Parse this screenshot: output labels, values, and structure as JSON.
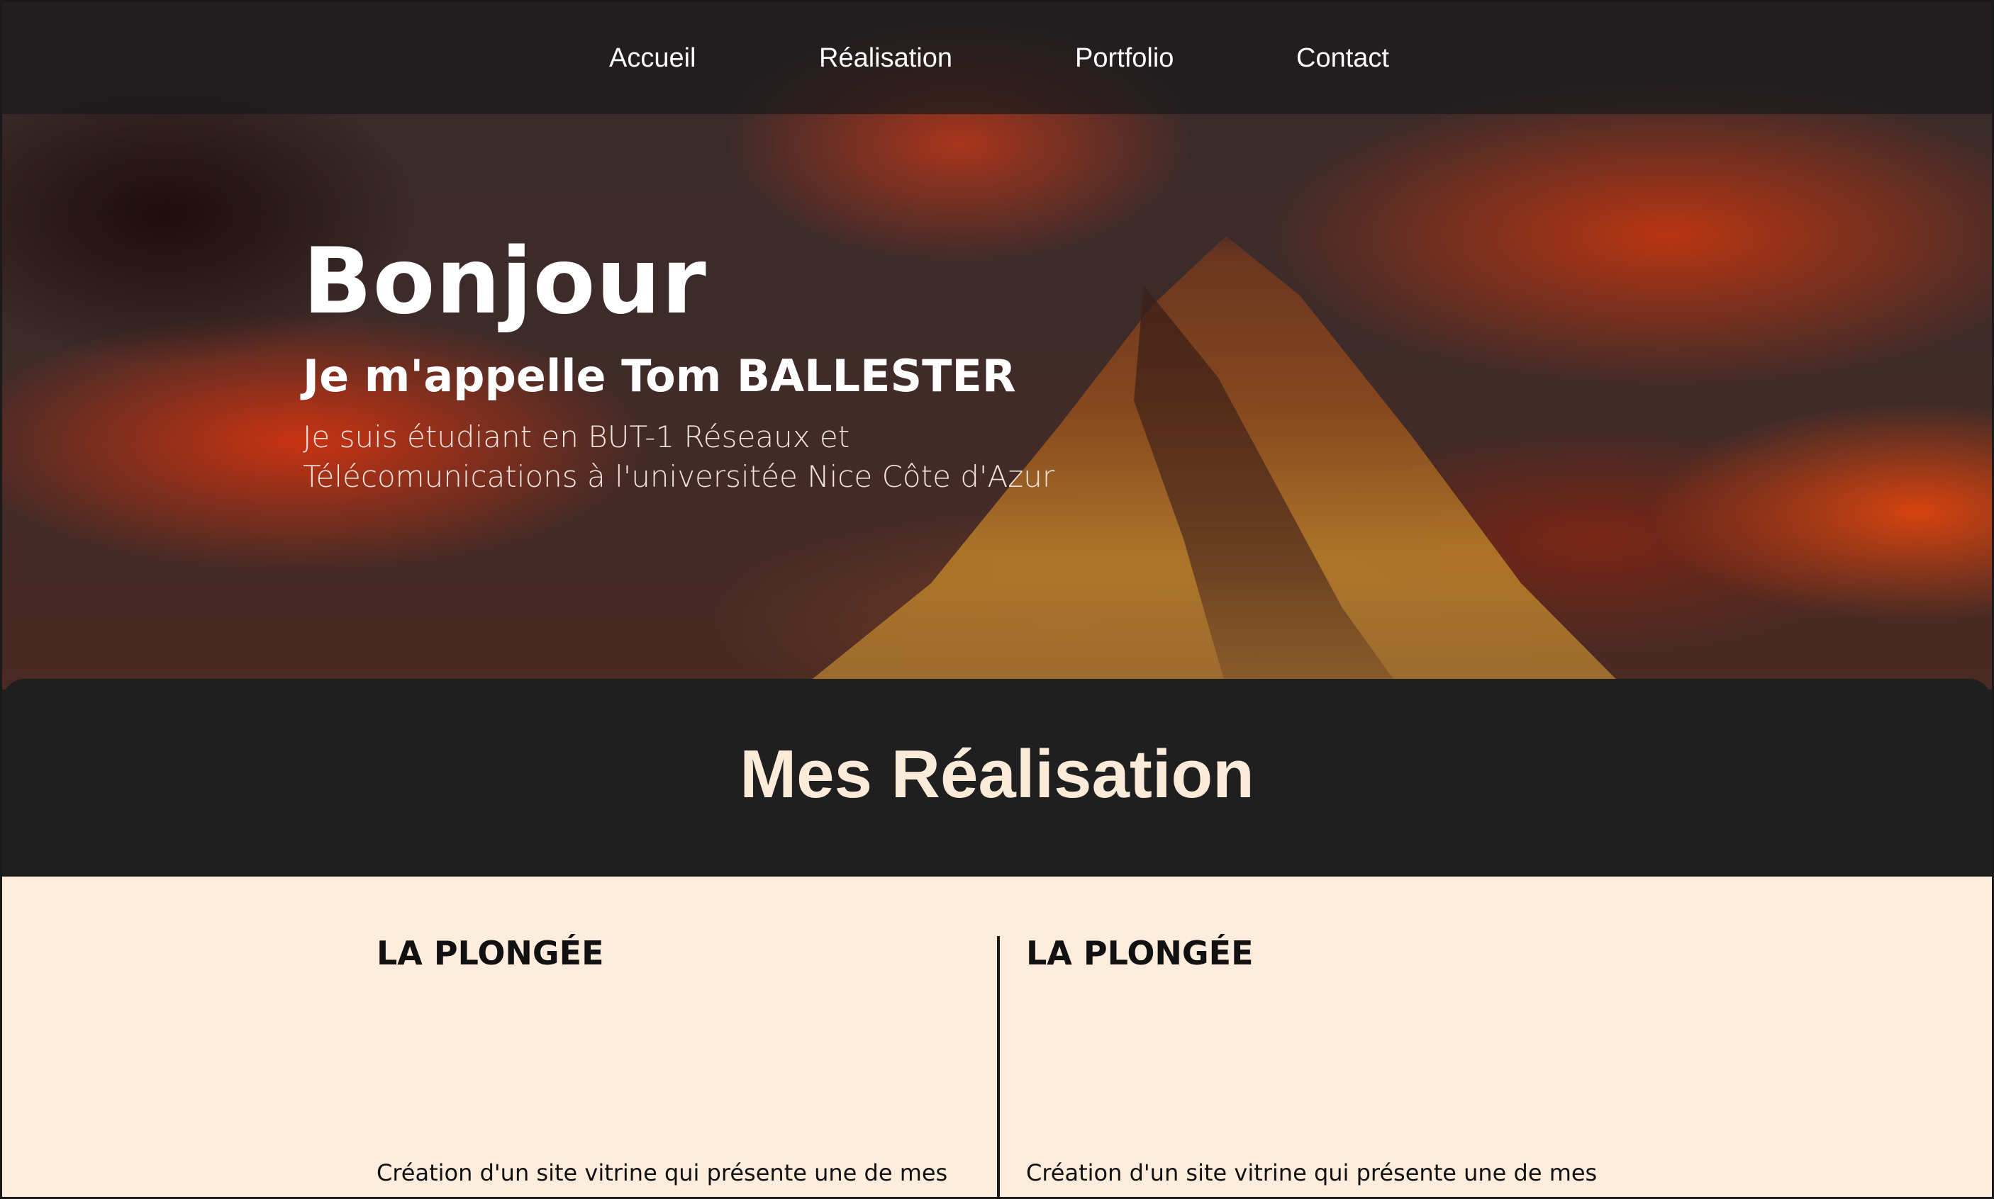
{
  "nav": {
    "items": [
      {
        "label": "Accueil"
      },
      {
        "label": "Réalisation"
      },
      {
        "label": "Portfolio"
      },
      {
        "label": "Contact"
      }
    ]
  },
  "hero": {
    "title": "Bonjour",
    "subtitle": "Je m'appelle Tom BALLESTER",
    "description": "Je suis étudiant en BUT-1 Réseaux et Télécomunications à l'universitée Nice Côte d'Azur"
  },
  "realisations": {
    "title": "Mes Réalisation",
    "cards": [
      {
        "title": "LA PLONGÉE",
        "description": "Création d'un site vitrine qui présente une de mes"
      },
      {
        "title": "LA PLONGÉE",
        "description": "Création d'un site vitrine qui présente une de mes"
      }
    ]
  },
  "colors": {
    "section_title": "#fcebd9",
    "content_background": "#feeddd",
    "dark_band": "#1f1f1f"
  }
}
